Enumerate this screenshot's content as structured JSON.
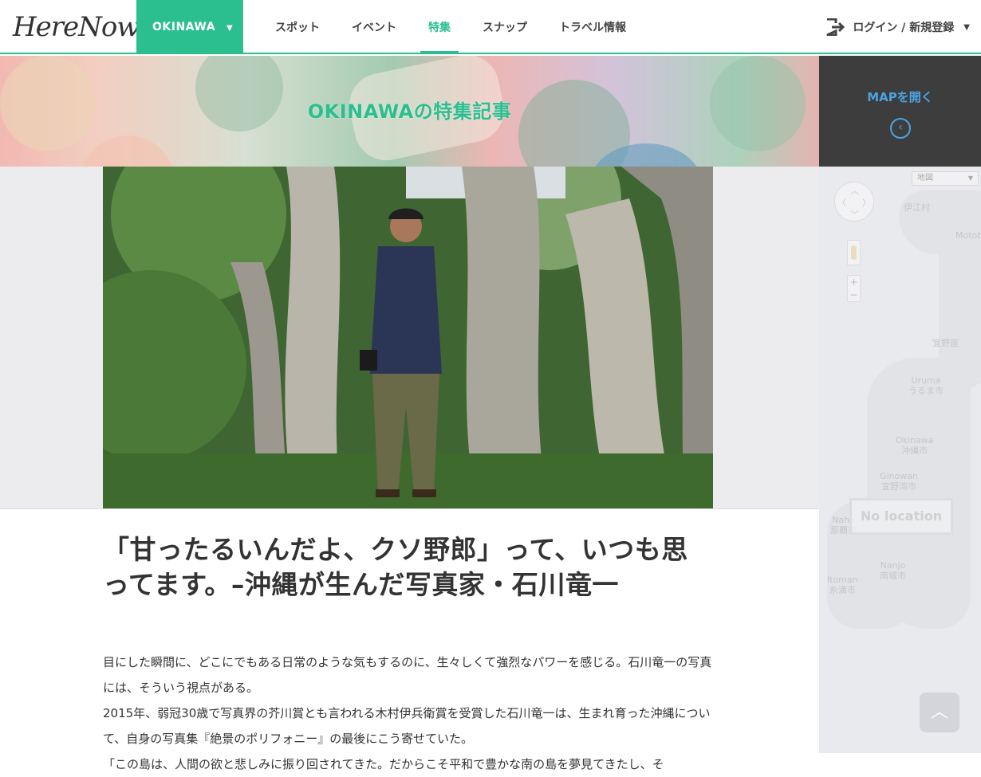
{
  "header": {
    "logo": "HereNow",
    "city": "OKINAWA",
    "nav": [
      {
        "label": "スポット"
      },
      {
        "label": "イベント"
      },
      {
        "label": "特集"
      },
      {
        "label": "スナップ"
      },
      {
        "label": "トラベル情報"
      }
    ],
    "active_nav": "特集",
    "login_label": "ログイン / 新規登録"
  },
  "banner": {
    "title": "OKINAWAの特集記事"
  },
  "map": {
    "open_label": "MAPを開く",
    "type_select": "地図",
    "no_location": "No location",
    "labels": {
      "iheya": "伊江村",
      "motobu": "Motobu",
      "ginoza": "宜野座",
      "uruma": "Uruma\nうるま市",
      "okinawa": "Okinawa\n沖縄市",
      "ginowan": "Ginowan\n宜野湾市",
      "naha": "Naha\n那覇市",
      "nanjo": "Nanjo\n南城市",
      "itoman": "Itoman\n糸満市"
    }
  },
  "article": {
    "title": "「甘ったるいんだよ、クソ野郎」って、いつも思ってます。–沖縄が生んだ写真家・石川竜一",
    "paragraphs": [
      "目にした瞬間に、どこにでもある日常のような気もするのに、生々しくて強烈なパワーを感じる。石川竜一の写真には、そういう視点がある。",
      "2015年、弱冠30歳で写真界の芥川賞とも言われる木村伊兵衛賞を受賞した石川竜一は、生まれ育った沖縄について、自身の写真集『絶景のポリフォニー』の最後にこう寄せていた。",
      "「この島は、人間の欲と悲しみに振り回されてきた。だからこそ平和で豊かな南の島を夢見てきたし、そ"
    ]
  },
  "colors": {
    "accent": "#2bbf90",
    "map_link": "#4aa3e3",
    "map_head_bg": "#3d3d3d"
  }
}
